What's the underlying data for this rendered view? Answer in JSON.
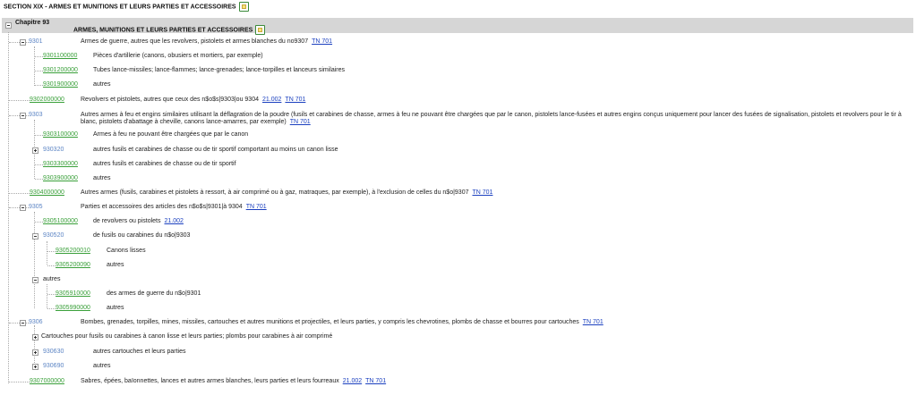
{
  "section": {
    "title": "SECTION XIX - ARMES ET MUNITIONS ET LEURS PARTIES ET ACCESSOIRES"
  },
  "chapter": {
    "label": "Chapitre 93",
    "title": "ARMES, MUNITIONS ET LEURS PARTIES ET ACCESSOIRES"
  },
  "rows": [
    {
      "code": "9301",
      "desc": "Armes de guerre, autres que les revolvers, pistolets et armes blanches du no9307",
      "links": [
        "TN 701"
      ]
    },
    {
      "code": "9301100000",
      "desc": "Pièces d'artillerie (canons, obusiers et mortiers, par exemple)",
      "links": []
    },
    {
      "code": "9301200000",
      "desc": "Tubes lance-missiles; lance-flammes; lance-grenades; lance-torpilles et lanceurs similaires",
      "links": []
    },
    {
      "code": "9301900000",
      "desc": "autres",
      "links": []
    },
    {
      "code": "9302000000",
      "desc": "Revolvers et pistolets, autres que ceux des n$o$s|9303|ou 9304",
      "links": [
        "21.002",
        "TN 701"
      ]
    },
    {
      "code": "9303",
      "desc": "Autres armes à feu et engins similaires utilisant la déflagration de la poudre (fusils et carabines de chasse, armes à feu ne pouvant être chargées que par le canon, pistolets lance-fusées et autres engins conçus uniquement pour lancer des fusées de signalisation, pistolets et revolvers pour le tir à blanc, pistolets d'abattage à cheville, canons lance-amarres, par exemple)",
      "links": [
        "TN 701"
      ]
    },
    {
      "code": "9303100000",
      "desc": "Armes à feu ne pouvant être chargées que par le canon",
      "links": []
    },
    {
      "code": "930320",
      "desc": "autres fusils et carabines de chasse ou de tir sportif comportant au moins un canon lisse",
      "links": []
    },
    {
      "code": "9303300000",
      "desc": "autres fusils et carabines de chasse ou de tir sportif",
      "links": []
    },
    {
      "code": "9303900000",
      "desc": "autres",
      "links": []
    },
    {
      "code": "9304000000",
      "desc": "Autres armes (fusils, carabines et pistolets à ressort, à air comprimé ou à gaz, matraques, par exemple), à l'exclusion de celles du n$o|9307",
      "links": [
        "TN 701"
      ]
    },
    {
      "code": "9305",
      "desc": "Parties et accessoires des articles des n$o$s|9301|à 9304",
      "links": [
        "TN 701"
      ]
    },
    {
      "code": "9305100000",
      "desc": "de revolvers ou pistolets",
      "links": [
        "21.002"
      ]
    },
    {
      "code": "930520",
      "desc": "de fusils ou carabines du n$o|9303",
      "links": []
    },
    {
      "code": "9305200010",
      "desc": "Canons lisses",
      "links": []
    },
    {
      "code": "9305200090",
      "desc": "autres",
      "links": []
    },
    {
      "code": "",
      "desc": "autres",
      "links": []
    },
    {
      "code": "9305910000",
      "desc": "des armes de guerre du n$o|9301",
      "links": []
    },
    {
      "code": "9305990000",
      "desc": "autres",
      "links": []
    },
    {
      "code": "9306",
      "desc": "Bombes, grenades, torpilles, mines, missiles, cartouches et autres munitions et projectiles, et leurs parties, y compris les chevrotines, plombs de chasse et bourres pour cartouches",
      "links": [
        "TN 701"
      ]
    },
    {
      "code": "",
      "desc": "Cartouches pour fusils ou carabines à canon lisse et leurs parties; plombs pour carabines à air comprimé",
      "links": []
    },
    {
      "code": "930630",
      "desc": "autres cartouches et leurs parties",
      "links": []
    },
    {
      "code": "930690",
      "desc": "autres",
      "links": []
    },
    {
      "code": "9307000000",
      "desc": "Sabres, épées, baïonnettes, lances et autres armes blanches, leurs parties et leurs fourreaux",
      "links": [
        "21.002",
        "TN 701"
      ]
    }
  ]
}
